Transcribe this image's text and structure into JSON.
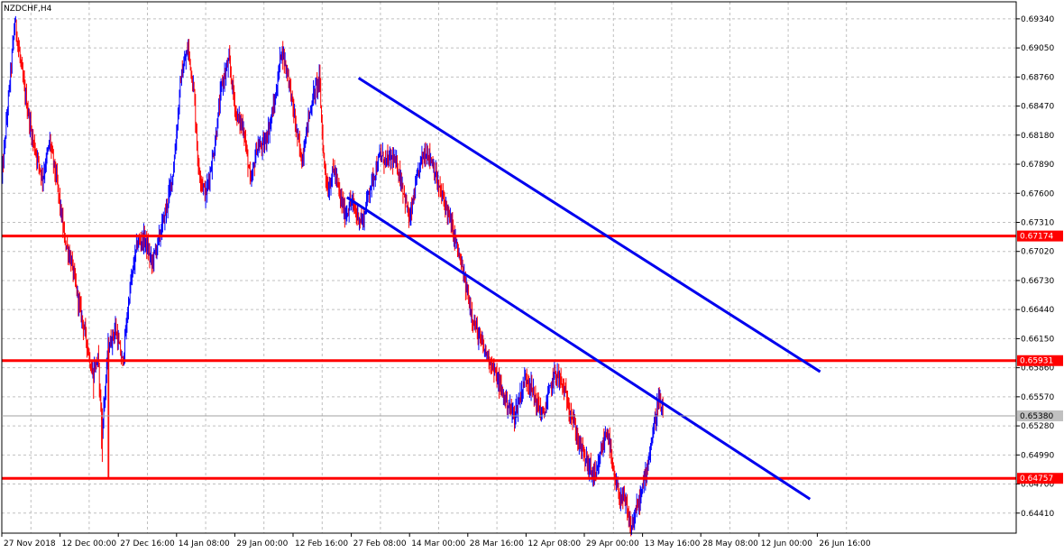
{
  "chart_data": {
    "type": "line",
    "symbol": "NZDCHF,H4",
    "x_tick_labels": [
      "27 Nov 2018",
      "12 Dec 00:00",
      "27 Dec 16:00",
      "14 Jan 08:00",
      "29 Jan 00:00",
      "12 Feb 16:00",
      "27 Feb 08:00",
      "14 Mar 00:00",
      "28 Mar 16:00",
      "12 Apr 08:00",
      "29 Apr 00:00",
      "13 May 16:00",
      "28 May 08:00",
      "12 Jun 00:00",
      "26 Jun 16:00"
    ],
    "y_ticks": [
      0.6934,
      0.6905,
      0.6876,
      0.6847,
      0.6818,
      0.6789,
      0.676,
      0.6731,
      0.6702,
      0.6673,
      0.6644,
      0.6615,
      0.6586,
      0.6557,
      0.6528,
      0.6499,
      0.647,
      0.6441
    ],
    "y_tick_labels": [
      "0.69340",
      "0.69050",
      "0.68760",
      "0.68470",
      "0.68180",
      "0.67890",
      "0.67600",
      "0.67310",
      "0.67020",
      "0.66730",
      "0.66440",
      "0.66150",
      "0.65860",
      "0.65570",
      "0.65280",
      "0.64990",
      "0.64700",
      "0.64410"
    ],
    "ylim": [
      0.6421,
      0.6951
    ],
    "grid": true,
    "price_series": {
      "name": "NZDCHF",
      "bars_per_label": 80,
      "points": [
        [
          0,
          0.6775
        ],
        [
          8,
          0.6845
        ],
        [
          18,
          0.6932
        ],
        [
          30,
          0.6868
        ],
        [
          42,
          0.6815
        ],
        [
          56,
          0.6775
        ],
        [
          66,
          0.6812
        ],
        [
          76,
          0.677
        ],
        [
          86,
          0.6715
        ],
        [
          96,
          0.669
        ],
        [
          106,
          0.665
        ],
        [
          116,
          0.6615
        ],
        [
          124,
          0.658
        ],
        [
          132,
          0.6595
        ],
        [
          138,
          0.6525
        ],
        [
          146,
          0.6605
        ],
        [
          156,
          0.6625
        ],
        [
          166,
          0.659
        ],
        [
          176,
          0.6665
        ],
        [
          186,
          0.671
        ],
        [
          196,
          0.6715
        ],
        [
          206,
          0.669
        ],
        [
          216,
          0.6715
        ],
        [
          226,
          0.6745
        ],
        [
          236,
          0.6785
        ],
        [
          246,
          0.6875
        ],
        [
          256,
          0.6905
        ],
        [
          264,
          0.686
        ],
        [
          270,
          0.6785
        ],
        [
          280,
          0.6758
        ],
        [
          292,
          0.6805
        ],
        [
          302,
          0.6868
        ],
        [
          312,
          0.6892
        ],
        [
          322,
          0.6838
        ],
        [
          332,
          0.6825
        ],
        [
          342,
          0.6768
        ],
        [
          350,
          0.6805
        ],
        [
          360,
          0.6808
        ],
        [
          368,
          0.6828
        ],
        [
          376,
          0.6855
        ],
        [
          384,
          0.6905
        ],
        [
          394,
          0.6875
        ],
        [
          404,
          0.6825
        ],
        [
          412,
          0.6792
        ],
        [
          420,
          0.683
        ],
        [
          428,
          0.6858
        ],
        [
          436,
          0.6875
        ],
        [
          442,
          0.6795
        ],
        [
          448,
          0.6762
        ],
        [
          456,
          0.6785
        ],
        [
          464,
          0.6758
        ],
        [
          472,
          0.6738
        ],
        [
          480,
          0.6752
        ],
        [
          488,
          0.6738
        ],
        [
          496,
          0.6732
        ],
        [
          504,
          0.6762
        ],
        [
          512,
          0.678
        ],
        [
          520,
          0.6798
        ],
        [
          528,
          0.6792
        ],
        [
          536,
          0.6795
        ],
        [
          544,
          0.6785
        ],
        [
          552,
          0.6762
        ],
        [
          560,
          0.6732
        ],
        [
          568,
          0.6765
        ],
        [
          576,
          0.6795
        ],
        [
          584,
          0.6802
        ],
        [
          592,
          0.679
        ],
        [
          600,
          0.6765
        ],
        [
          608,
          0.6752
        ],
        [
          616,
          0.6732
        ],
        [
          624,
          0.671
        ],
        [
          632,
          0.6685
        ],
        [
          640,
          0.6658
        ],
        [
          648,
          0.6632
        ],
        [
          656,
          0.6615
        ],
        [
          664,
          0.6602
        ],
        [
          672,
          0.6592
        ],
        [
          680,
          0.6575
        ],
        [
          688,
          0.656
        ],
        [
          696,
          0.6548
        ],
        [
          704,
          0.6538
        ],
        [
          712,
          0.6558
        ],
        [
          720,
          0.6578
        ],
        [
          728,
          0.6565
        ],
        [
          736,
          0.6548
        ],
        [
          744,
          0.6538
        ],
        [
          752,
          0.6562
        ],
        [
          760,
          0.6582
        ],
        [
          768,
          0.6572
        ],
        [
          776,
          0.6555
        ],
        [
          784,
          0.6535
        ],
        [
          792,
          0.6512
        ],
        [
          800,
          0.6498
        ],
        [
          808,
          0.6485
        ],
        [
          816,
          0.6475
        ],
        [
          824,
          0.6505
        ],
        [
          832,
          0.6525
        ],
        [
          840,
          0.6478
        ],
        [
          848,
          0.6458
        ],
        [
          856,
          0.6452
        ],
        [
          864,
          0.6425
        ],
        [
          872,
          0.6445
        ],
        [
          880,
          0.6465
        ],
        [
          888,
          0.6495
        ],
        [
          896,
          0.6528
        ],
        [
          902,
          0.6555
        ],
        [
          908,
          0.6538
        ]
      ]
    },
    "horizontal_levels": [
      {
        "value": 0.67174,
        "label": "0.67174",
        "color": "#ff0000"
      },
      {
        "value": 0.65931,
        "label": "0.65931",
        "color": "#ff0000"
      },
      {
        "value": 0.64757,
        "label": "0.64757",
        "color": "#ff0000"
      }
    ],
    "current_price": {
      "value": 0.6538,
      "label": "0.65380"
    },
    "trend_lines": [
      {
        "x1": 490,
        "y1": 0.6875,
        "x2": 1124,
        "y2": 0.6582,
        "color": "#0000ee"
      },
      {
        "x1": 474,
        "y1": 0.6756,
        "x2": 1110,
        "y2": 0.6455,
        "color": "#0000ee"
      }
    ],
    "colors": {
      "bull": "#0000ff",
      "bear": "#ff0000",
      "level": "#ff0000",
      "trend": "#0000ee",
      "grid": "#c0c0c0",
      "price_tag": "#c0c0c0"
    }
  }
}
